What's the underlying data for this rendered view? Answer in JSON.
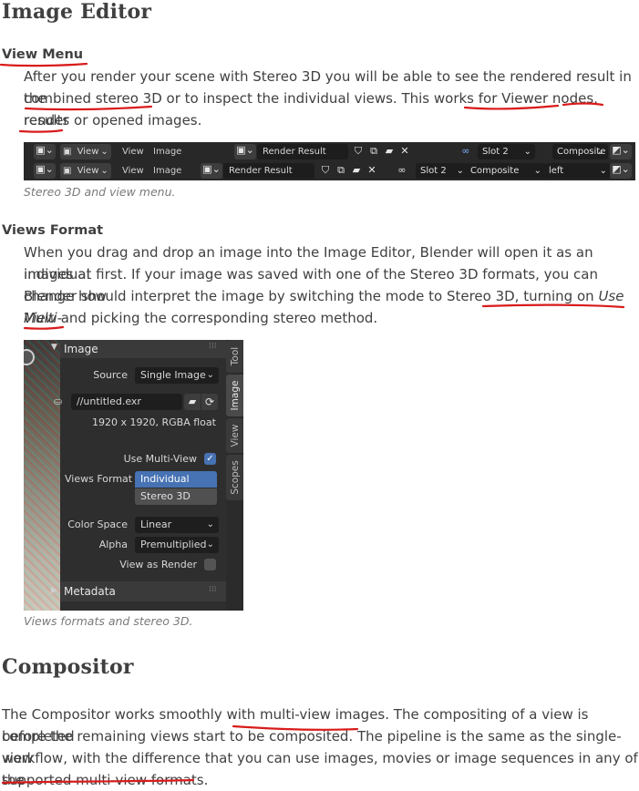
{
  "sections": {
    "image_editor": {
      "title": "Image Editor",
      "view_menu": {
        "heading": "View Menu",
        "para_lines": [
          "After you render your scene with Stereo 3D you will be able to see the rendered result in the",
          "combined stereo 3D or to inspect the individual views. This works for Viewer nodes, render",
          "results or opened images."
        ],
        "caption": "Stereo 3D and view menu."
      },
      "views_format": {
        "heading": "Views Format",
        "line1": "When you drag and drop an image into the Image Editor, Blender will open it as an individual",
        "line2": "images at first. If your image was saved with one of the Stereo 3D formats, you can change how",
        "line3_a": "Blender should interpret the image by switching the mode to Stereo 3D, turning on ",
        "line3_em": "Use Multi-",
        "line4_em": "View",
        "line4_b": " and picking the corresponding stereo method.",
        "caption": "Views formats and stereo 3D."
      }
    },
    "compositor": {
      "title": "Compositor",
      "para_lines": [
        "The Compositor works smoothly with multi-view images. The compositing of a view is completed",
        "before the remaining views start to be composited. The pipeline is the same as the single-view",
        "workflow, with the difference that you can use images, movies or image sequences in any of the",
        "supported multi-view formats."
      ]
    }
  },
  "header_bar_1": {
    "view_menu": "View",
    "view": "View",
    "image": "Image",
    "image_name": "Render Result",
    "slot": "Slot 2",
    "layer": "Composite"
  },
  "header_bar_2": {
    "view_menu": "View",
    "view": "View",
    "image": "Image",
    "image_name": "Render Result",
    "slot": "Slot 2",
    "layer": "Composite",
    "eye": "left"
  },
  "image_panel": {
    "title": "Image",
    "source_label": "Source",
    "source_value": "Single Image",
    "filepath": "//untitled.exr",
    "info": "1920 x 1920,  RGBA float",
    "use_multiview_label": "Use Multi-View",
    "use_multiview_checked": true,
    "views_format_label": "Views Format",
    "views_format_options": [
      "Individual",
      "Stereo 3D"
    ],
    "views_format_selected": "Individual",
    "color_space_label": "Color Space",
    "color_space_value": "Linear",
    "alpha_label": "Alpha",
    "alpha_value": "Premultiplied",
    "view_as_render_label": "View as Render",
    "view_as_render_checked": false,
    "metadata_title": "Metadata",
    "tabs": [
      "Tool",
      "Image",
      "View",
      "Scopes"
    ],
    "active_tab": "Image"
  },
  "colors": {
    "text": "#404040",
    "caption": "#7a7a7a",
    "annotation_red": "#d91b1b",
    "blender_bg": "#282828",
    "blender_select": "#4772b3"
  },
  "icons": [
    "image-editor-icon",
    "image-browse-icon",
    "shield-icon",
    "duplicate-icon",
    "folder-icon",
    "close-icon",
    "stereo-glasses-icon",
    "refresh-icon",
    "checkbox-icon",
    "disclosure-triangle-icon",
    "drag-handle-icon"
  ]
}
